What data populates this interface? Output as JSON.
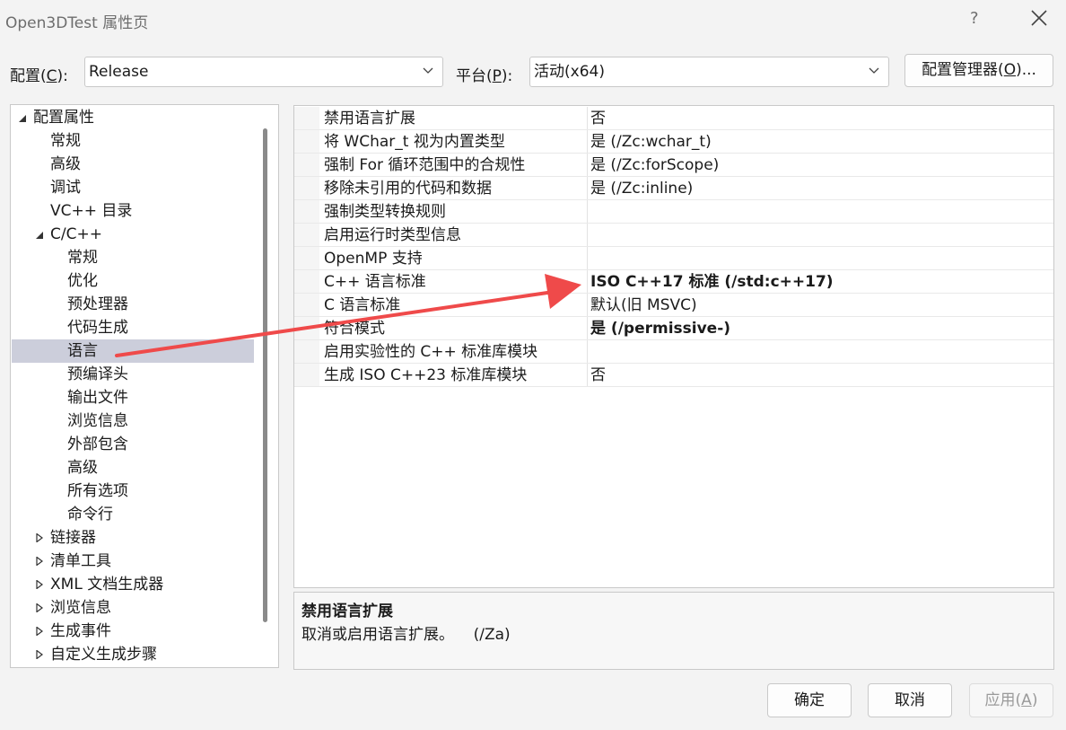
{
  "window": {
    "title": "Open3DTest 属性页",
    "help_label": "?"
  },
  "toolbar": {
    "config_label_prefix": "配置(",
    "config_label_key": "C",
    "config_label_suffix": "):",
    "config_value": "Release",
    "platform_label_prefix": "平台(",
    "platform_label_key": "P",
    "platform_label_suffix": "):",
    "platform_value": "活动(x64)",
    "config_manager_prefix": "配置管理器(",
    "config_manager_key": "O",
    "config_manager_suffix": ")..."
  },
  "tree": {
    "items": [
      {
        "label": "配置属性"
      },
      {
        "label": "常规"
      },
      {
        "label": "高级"
      },
      {
        "label": "调试"
      },
      {
        "label": "VC++ 目录"
      },
      {
        "label": "C/C++"
      },
      {
        "label": "常规"
      },
      {
        "label": "优化"
      },
      {
        "label": "预处理器"
      },
      {
        "label": "代码生成"
      },
      {
        "label": "语言"
      },
      {
        "label": "预编译头"
      },
      {
        "label": "输出文件"
      },
      {
        "label": "浏览信息"
      },
      {
        "label": "外部包含"
      },
      {
        "label": "高级"
      },
      {
        "label": "所有选项"
      },
      {
        "label": "命令行"
      },
      {
        "label": "链接器"
      },
      {
        "label": "清单工具"
      },
      {
        "label": "XML 文档生成器"
      },
      {
        "label": "浏览信息"
      },
      {
        "label": "生成事件"
      },
      {
        "label": "自定义生成步骤"
      }
    ]
  },
  "properties": {
    "rows": [
      {
        "name": "禁用语言扩展",
        "value": "否"
      },
      {
        "name": "将 WChar_t 视为内置类型",
        "value": "是 (/Zc:wchar_t)"
      },
      {
        "name": "强制 For 循环范围中的合规性",
        "value": "是 (/Zc:forScope)"
      },
      {
        "name": "移除未引用的代码和数据",
        "value": "是 (/Zc:inline)"
      },
      {
        "name": "强制类型转换规则",
        "value": ""
      },
      {
        "name": "启用运行时类型信息",
        "value": ""
      },
      {
        "name": "OpenMP 支持",
        "value": ""
      },
      {
        "name": "C++ 语言标准",
        "value": "ISO C++17 标准 (/std:c++17)"
      },
      {
        "name": "C 语言标准",
        "value": "默认(旧 MSVC)"
      },
      {
        "name": "符合模式",
        "value": "是 (/permissive-)"
      },
      {
        "name": "启用实验性的 C++ 标准库模块",
        "value": ""
      },
      {
        "name": "生成 ISO C++23 标准库模块",
        "value": "否"
      }
    ]
  },
  "description": {
    "title": "禁用语言扩展",
    "text": "取消或启用语言扩展。    (/Za)"
  },
  "buttons": {
    "ok": "确定",
    "cancel": "取消",
    "apply_prefix": "应用(",
    "apply_key": "A",
    "apply_suffix": ")"
  },
  "colors": {
    "selection": "#cccedb",
    "annotation_arrow": "#ef4a4a"
  }
}
